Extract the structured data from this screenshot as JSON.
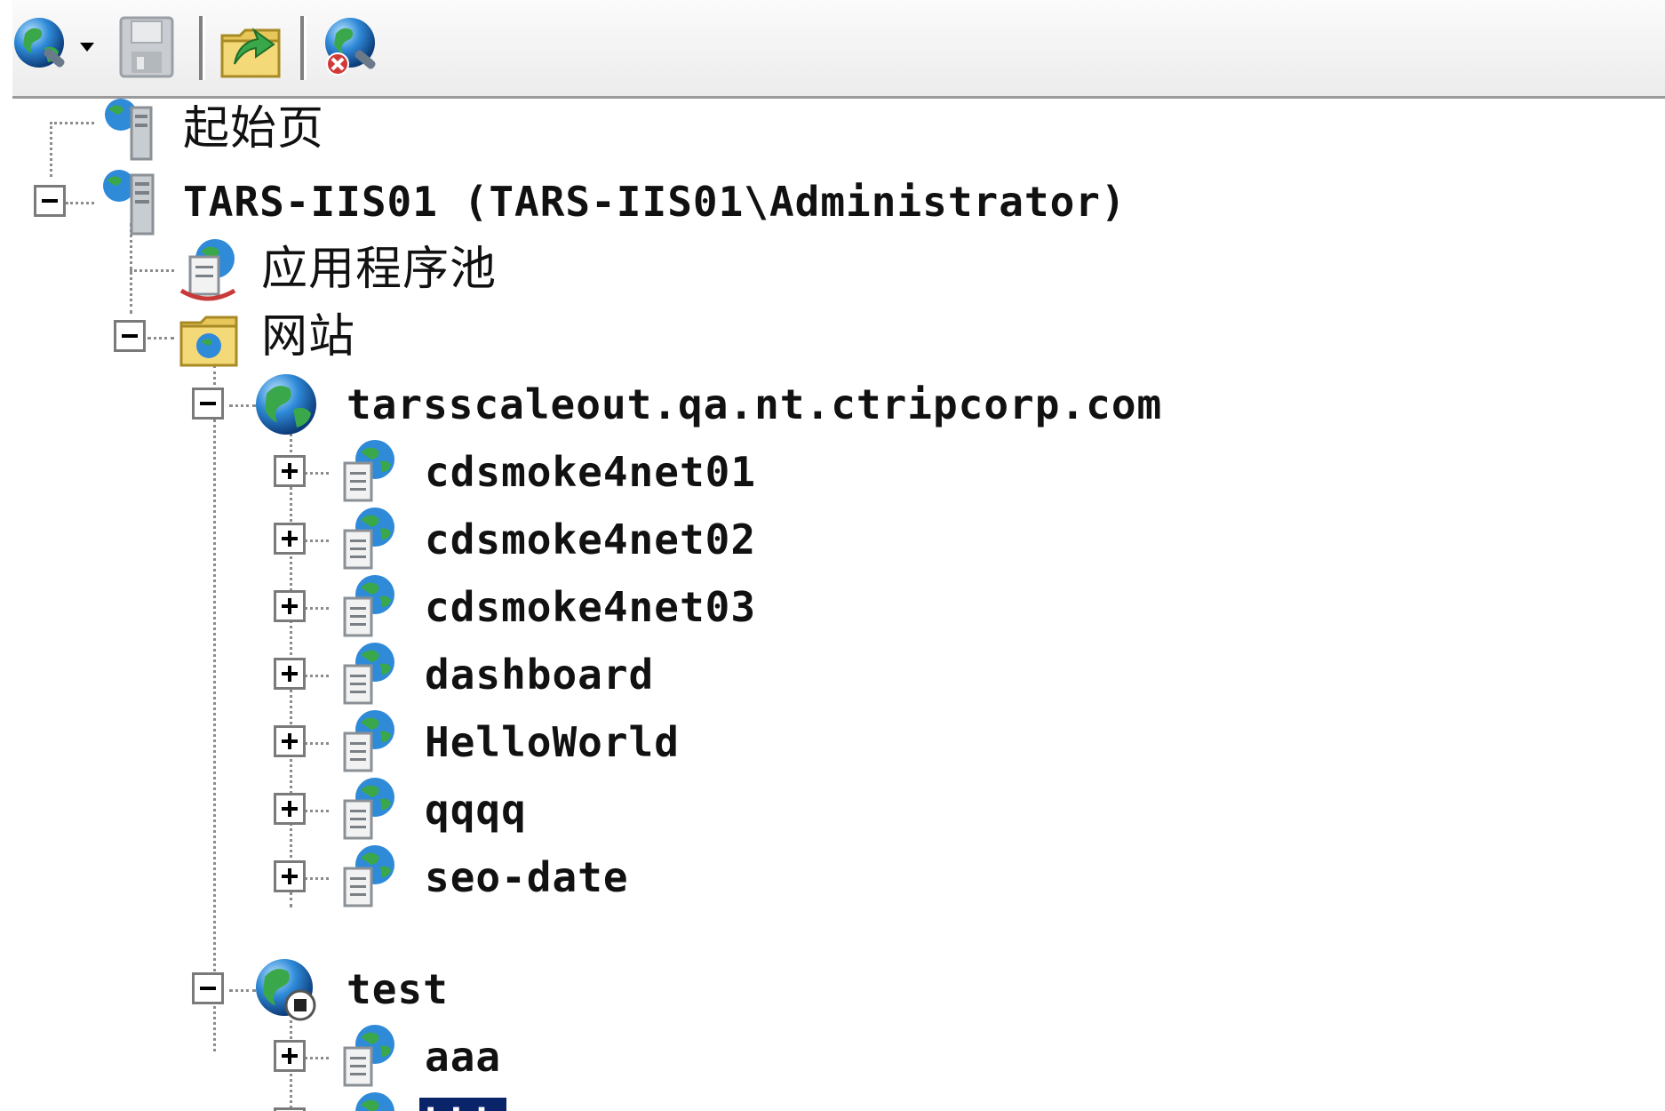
{
  "toolbar": {
    "buttons": [
      {
        "name": "connect",
        "icon": "globe-connect-icon"
      },
      {
        "name": "save",
        "icon": "save-icon"
      },
      {
        "name": "up",
        "icon": "folder-up-icon"
      },
      {
        "name": "disconnect",
        "icon": "disconnect-icon"
      }
    ]
  },
  "tree": {
    "start_page": "起始页",
    "server": "TARS-IIS01 (TARS-IIS01\\Administrator)",
    "app_pools": "应用程序池",
    "sites": "网站",
    "site1": {
      "name": "tarsscaleout.qa.nt.ctripcorp.com",
      "apps": [
        "cdsmoke4net01",
        "cdsmoke4net02",
        "cdsmoke4net03",
        "dashboard",
        "HelloWorld",
        "qqqq",
        "seo-date"
      ]
    },
    "site2": {
      "name": "test",
      "apps": [
        "aaa",
        "bbb"
      ]
    },
    "selected": "bbb"
  },
  "colors": {
    "selection": "#0a246a",
    "tree_lines": "#8c8c8c",
    "toolbar_border": "#9a9a9a"
  }
}
